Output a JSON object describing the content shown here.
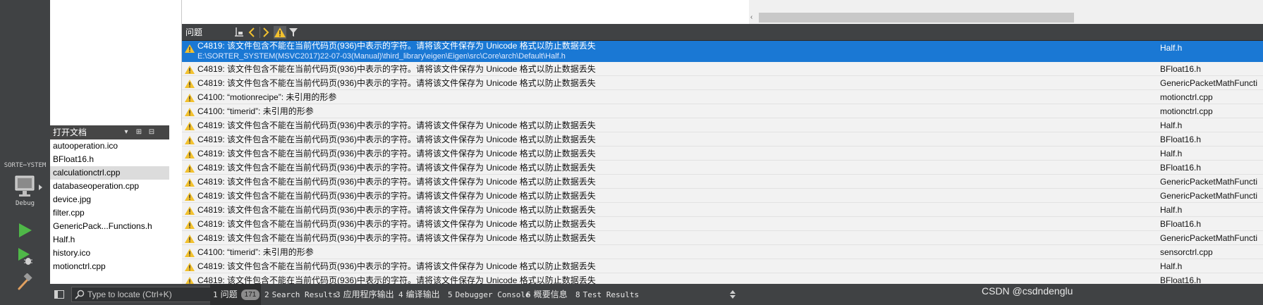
{
  "mode_bar": {
    "project_label": "SORTE⋯YSTEM",
    "mode_label": "Debug",
    "icons": [
      "monitor-icon",
      "run-icon",
      "run-debug-icon",
      "hammer-icon"
    ]
  },
  "open_documents": {
    "title": "打开文档",
    "items": [
      {
        "label": "autooperation.ico"
      },
      {
        "label": "BFloat16.h"
      },
      {
        "label": "calculationctrl.cpp"
      },
      {
        "label": "databaseoperation.cpp"
      },
      {
        "label": "device.jpg"
      },
      {
        "label": "filter.cpp"
      },
      {
        "label": "GenericPack...Functions.h"
      },
      {
        "label": "Half.h"
      },
      {
        "label": "history.ico"
      },
      {
        "label": "motionctrl.cpp"
      }
    ],
    "selected_index": 2
  },
  "issues_panel": {
    "title": "问题",
    "selected": {
      "message": "C4819: 该文件包含不能在当前代码页(936)中表示的字符。请将该文件保存为 Unicode 格式以防止数据丢失",
      "path": "E:\\SORTER_SYSTEM(MSVC2017)22-07-03(Manual)\\third_library\\eigen\\Eigen\\src\\Core\\arch\\Default\\Half.h",
      "file": "Half.h"
    },
    "rows": [
      {
        "message": "C4819: 该文件包含不能在当前代码页(936)中表示的字符。请将该文件保存为 Unicode 格式以防止数据丢失",
        "file": "BFloat16.h"
      },
      {
        "message": "C4819: 该文件包含不能在当前代码页(936)中表示的字符。请将该文件保存为 Unicode 格式以防止数据丢失",
        "file": "GenericPacketMathFuncti"
      },
      {
        "message": "C4100: “motionrecipe”: 未引用的形参",
        "file": "motionctrl.cpp"
      },
      {
        "message": "C4100: “timerid”: 未引用的形参",
        "file": "motionctrl.cpp"
      },
      {
        "message": "C4819: 该文件包含不能在当前代码页(936)中表示的字符。请将该文件保存为 Unicode 格式以防止数据丢失",
        "file": "Half.h"
      },
      {
        "message": "C4819: 该文件包含不能在当前代码页(936)中表示的字符。请将该文件保存为 Unicode 格式以防止数据丢失",
        "file": "BFloat16.h"
      },
      {
        "message": "C4819: 该文件包含不能在当前代码页(936)中表示的字符。请将该文件保存为 Unicode 格式以防止数据丢失",
        "file": "Half.h"
      },
      {
        "message": "C4819: 该文件包含不能在当前代码页(936)中表示的字符。请将该文件保存为 Unicode 格式以防止数据丢失",
        "file": "BFloat16.h"
      },
      {
        "message": "C4819: 该文件包含不能在当前代码页(936)中表示的字符。请将该文件保存为 Unicode 格式以防止数据丢失",
        "file": "GenericPacketMathFuncti"
      },
      {
        "message": "C4819: 该文件包含不能在当前代码页(936)中表示的字符。请将该文件保存为 Unicode 格式以防止数据丢失",
        "file": "GenericPacketMathFuncti"
      },
      {
        "message": "C4819: 该文件包含不能在当前代码页(936)中表示的字符。请将该文件保存为 Unicode 格式以防止数据丢失",
        "file": "Half.h"
      },
      {
        "message": "C4819: 该文件包含不能在当前代码页(936)中表示的字符。请将该文件保存为 Unicode 格式以防止数据丢失",
        "file": "BFloat16.h"
      },
      {
        "message": "C4819: 该文件包含不能在当前代码页(936)中表示的字符。请将该文件保存为 Unicode 格式以防止数据丢失",
        "file": "GenericPacketMathFuncti"
      },
      {
        "message": "C4100: “timerid”: 未引用的形参",
        "file": "sensorctrl.cpp"
      },
      {
        "message": "C4819: 该文件包含不能在当前代码页(936)中表示的字符。请将该文件保存为 Unicode 格式以防止数据丢失",
        "file": "Half.h"
      },
      {
        "message": "C4819: 该文件包含不能在当前代码页(936)中表示的字符。请将该文件保存为 Unicode 格式以防止数据丢失",
        "file": "BFloat16.h"
      }
    ]
  },
  "locator": {
    "placeholder": "Type to locate (Ctrl+K)"
  },
  "output_tabs": [
    {
      "num": "1",
      "label": "问题",
      "badge": "171"
    },
    {
      "num": "2",
      "label": "Search Results"
    },
    {
      "num": "3",
      "label": "应用程序输出"
    },
    {
      "num": "4",
      "label": "编译输出"
    },
    {
      "num": "5",
      "label": "Debugger Console"
    },
    {
      "num": "6",
      "label": "概要信息"
    },
    {
      "num": "8",
      "label": "Test Results"
    }
  ],
  "watermark": "CSDN @csdndenglu",
  "colors": {
    "selection": "#1a78d4",
    "warning": "#f2c12e",
    "run_green": "#4fb848",
    "dark_bar": "#404244"
  }
}
